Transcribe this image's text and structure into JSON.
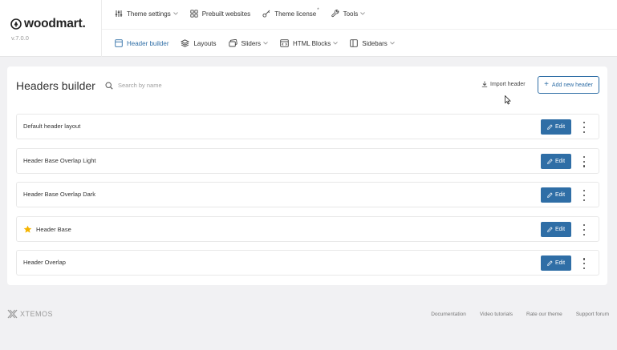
{
  "brand": {
    "name": "woodmart.",
    "version": "v.7.0.0"
  },
  "nav": {
    "row1": [
      {
        "label": "Theme settings",
        "chevron": true
      },
      {
        "label": "Prebuilt websites",
        "chevron": false
      },
      {
        "label": "Theme license",
        "sup": "*"
      },
      {
        "label": "Tools",
        "chevron": true
      }
    ],
    "row2": [
      {
        "label": "Header builder",
        "active": true
      },
      {
        "label": "Layouts"
      },
      {
        "label": "Sliders",
        "chevron": true
      },
      {
        "label": "HTML Blocks",
        "chevron": true
      },
      {
        "label": "Sidebars",
        "chevron": true
      }
    ]
  },
  "main": {
    "title": "Headers builder",
    "search_placeholder": "Search by name",
    "import_label": "Import header",
    "add_label": "Add new header",
    "edit_label": "Edit",
    "headers": [
      {
        "name": "Default header layout",
        "default": false
      },
      {
        "name": "Header Base Overlap Light",
        "default": false
      },
      {
        "name": "Header Base Overlap Dark",
        "default": false
      },
      {
        "name": "Header Base",
        "default": true
      },
      {
        "name": "Header Overlap",
        "default": false
      }
    ]
  },
  "footer": {
    "logo_text": "XTEMOS",
    "links": [
      "Documentation",
      "Video tutorials",
      "Rate our theme",
      "Support forum"
    ]
  },
  "colors": {
    "accent": "#2f6ea6",
    "background": "#f1f1f3",
    "star": "#f5b400"
  }
}
